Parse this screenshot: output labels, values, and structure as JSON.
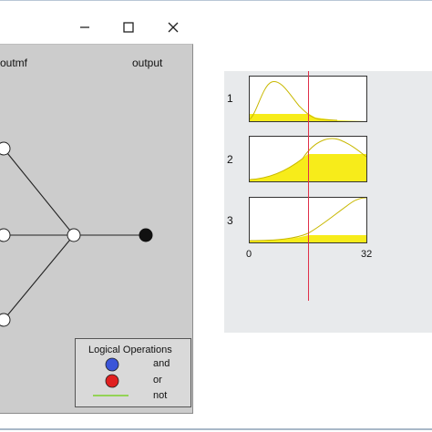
{
  "window": {
    "controls": {
      "minimize_icon": "minimize-icon",
      "maximize_icon": "maximize-icon",
      "close_icon": "close-icon"
    }
  },
  "rule_structure": {
    "label_left": "outmf",
    "label_right": "output",
    "legend": {
      "title": "Logical Operations",
      "items": [
        {
          "label": "and",
          "color": "#3b55d8"
        },
        {
          "label": "or",
          "color": "#e02020"
        },
        {
          "label": "not",
          "color": "#7cd12b"
        }
      ]
    }
  },
  "rule_viewer": {
    "rules": [
      {
        "number": "1"
      },
      {
        "number": "2"
      },
      {
        "number": "3"
      }
    ],
    "axis": {
      "min_label": "0",
      "max_label": "32"
    },
    "fill_color": "#f7ec1a",
    "curve_color": "#c8b800",
    "cursor_color": "#e0304a"
  }
}
